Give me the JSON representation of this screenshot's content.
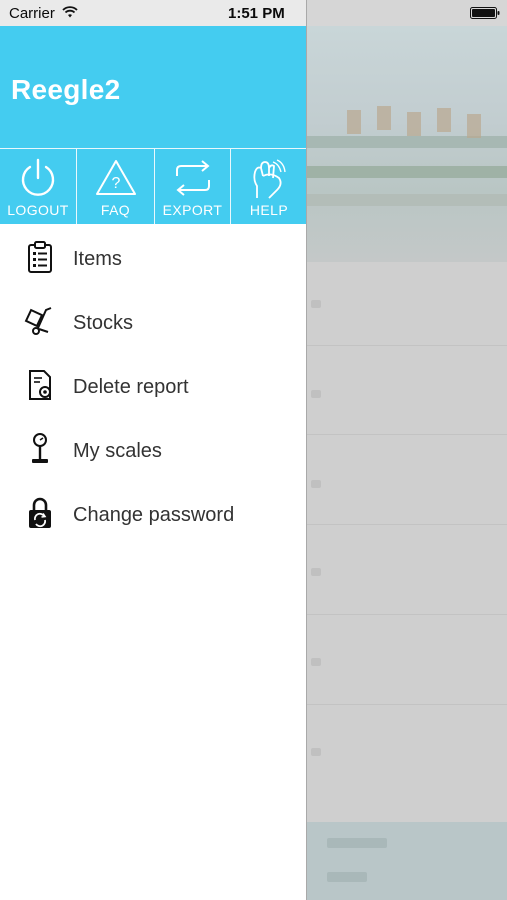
{
  "status_bar": {
    "carrier": "Carrier",
    "time": "1:51 PM"
  },
  "drawer": {
    "app_title": "Reegle2",
    "actions": [
      {
        "label": "LOGOUT",
        "icon": "power-icon"
      },
      {
        "label": "FAQ",
        "icon": "question-triangle-icon"
      },
      {
        "label": "EXPORT",
        "icon": "sync-arrows-icon"
      },
      {
        "label": "HELP",
        "icon": "hand-icon"
      }
    ],
    "menu": [
      {
        "label": "Items",
        "icon": "clipboard-list-icon"
      },
      {
        "label": "Stocks",
        "icon": "hand-truck-icon"
      },
      {
        "label": "Delete report",
        "icon": "report-gear-icon"
      },
      {
        "label": "My scales",
        "icon": "scale-icon"
      },
      {
        "label": "Change password",
        "icon": "lock-refresh-icon"
      }
    ]
  },
  "colors": {
    "header": "#44ccf0",
    "menu_text": "#333333",
    "overlay": "#c9c9c9"
  }
}
